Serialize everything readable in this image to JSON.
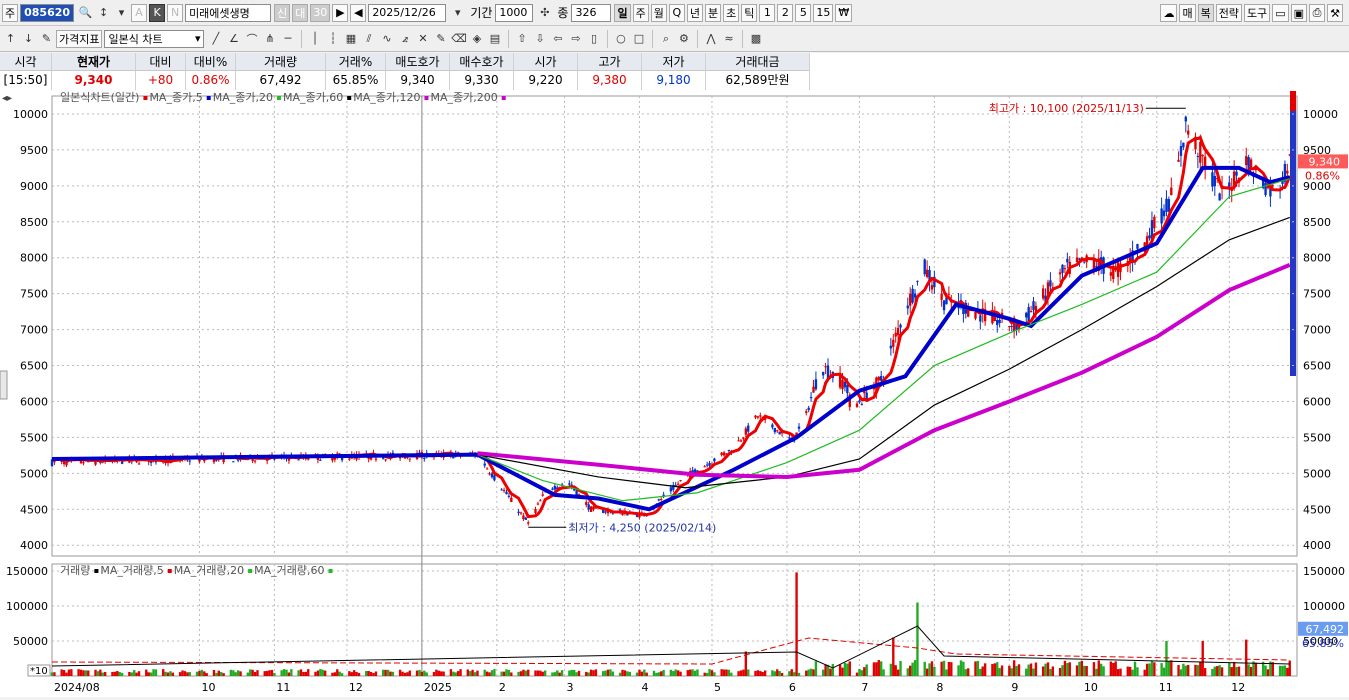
{
  "toolbar1": {
    "prefix": "주",
    "stock_code": "085620",
    "stock_name": "미래에셋생명",
    "badge1": "신",
    "badge2": "대",
    "badge3": "30",
    "date": "2025/12/26",
    "period_label": "기간",
    "period_value": "1000",
    "count_label": "종",
    "count_value": "326",
    "periods": [
      "일",
      "주",
      "월",
      "Q",
      "년",
      "분",
      "초",
      "틱",
      "1",
      "2",
      "5",
      "15"
    ],
    "right_buttons": [
      "매",
      "복",
      "전략",
      "도구"
    ]
  },
  "toolbar2": {
    "indicator_button": "가격지표",
    "chart_type": "일본식 차트",
    "view_button": "보기"
  },
  "quote": {
    "headers": [
      "시각",
      "현재가",
      "대비",
      "대비%",
      "거래량",
      "거래%",
      "매도호가",
      "매수호가",
      "시가",
      "고가",
      "저가",
      "거래대금"
    ],
    "values": [
      "[15:50]",
      "9,340",
      "+80",
      "0.86%",
      "67,492",
      "65.85%",
      "9,340",
      "9,330",
      "9,220",
      "9,380",
      "9,180",
      "62,589만원"
    ]
  },
  "legend": {
    "price_title": "일본식차트(일간)",
    "price_items": [
      {
        "label": "MA_종가,5",
        "color": "#e00000"
      },
      {
        "label": "MA_종가,20",
        "color": "#0000cc"
      },
      {
        "label": "MA_종가,60",
        "color": "#22bb22"
      },
      {
        "label": "MA_종가,120",
        "color": "#000000"
      },
      {
        "label": "MA_종가,200",
        "color": "#cc00cc"
      }
    ],
    "volume_title": "거래량",
    "volume_items": [
      {
        "label": "MA_거래량,5",
        "color": "#000000"
      },
      {
        "label": "MA_거래량,20",
        "color": "#e00000"
      },
      {
        "label": "MA_거래량,60",
        "color": "#22bb22"
      }
    ]
  },
  "annotations": {
    "high": "최고가 : 10,100 (2025/11/13)",
    "low": "최저가 : 4,250 (2025/02/14)",
    "current_price": "9,340",
    "current_change": "0.86%",
    "current_volume": "67,492",
    "volume_pct": "65.85%",
    "volume_unit": "*10"
  },
  "chart_data": {
    "type": "candlestick",
    "price_axis": {
      "ticks": [
        4000,
        4500,
        5000,
        5500,
        6000,
        6500,
        7000,
        7500,
        8000,
        8500,
        9000,
        9500,
        10000
      ],
      "ylim": [
        3850,
        10250
      ]
    },
    "volume_axis": {
      "ticks": [
        50000,
        100000,
        150000
      ],
      "ylim": [
        0,
        160000
      ]
    },
    "x_labels": [
      "2024/08",
      "10",
      "11",
      "12",
      "2025",
      "2",
      "3",
      "4",
      "5",
      "6",
      "7",
      "8",
      "9",
      "10",
      "11",
      "12"
    ],
    "price_anchors": [
      [
        "2024-08-01",
        5150
      ],
      [
        "2024-10-01",
        5200
      ],
      [
        "2024-12-01",
        5230
      ],
      [
        "2025-01-24",
        5260
      ],
      [
        "2025-02-14",
        4300
      ],
      [
        "2025-02-22",
        4800
      ],
      [
        "2025-03-03",
        4850
      ],
      [
        "2025-03-12",
        4500
      ],
      [
        "2025-04-03",
        4420
      ],
      [
        "2025-04-20",
        4950
      ],
      [
        "2025-05-10",
        5350
      ],
      [
        "2025-05-20",
        5800
      ],
      [
        "2025-06-03",
        5450
      ],
      [
        "2025-06-08",
        5700
      ],
      [
        "2025-06-15",
        6500
      ],
      [
        "2025-06-25",
        6250
      ],
      [
        "2025-06-28",
        5900
      ],
      [
        "2025-07-10",
        6300
      ],
      [
        "2025-07-20",
        7300
      ],
      [
        "2025-07-28",
        7850
      ],
      [
        "2025-08-05",
        7400
      ],
      [
        "2025-08-15",
        7300
      ],
      [
        "2025-08-25",
        7150
      ],
      [
        "2025-09-05",
        7050
      ],
      [
        "2025-09-10",
        7250
      ],
      [
        "2025-09-25",
        7850
      ],
      [
        "2025-10-05",
        7950
      ],
      [
        "2025-10-15",
        7800
      ],
      [
        "2025-10-25",
        8100
      ],
      [
        "2025-11-01",
        8500
      ],
      [
        "2025-11-08",
        8900
      ],
      [
        "2025-11-13",
        9850
      ],
      [
        "2025-11-19",
        9450
      ],
      [
        "2025-11-28",
        8850
      ],
      [
        "2025-12-08",
        9350
      ],
      [
        "2025-12-15",
        9050
      ],
      [
        "2025-12-20",
        8900
      ],
      [
        "2025-12-26",
        9340
      ]
    ],
    "ma": [
      {
        "name": "MA_종가,20",
        "color": "#0000cc",
        "points": [
          [
            "2024-08-01",
            5200
          ],
          [
            "2025-01-24",
            5260
          ],
          [
            "2025-02-25",
            4700
          ],
          [
            "2025-03-15",
            4650
          ],
          [
            "2025-04-05",
            4500
          ],
          [
            "2025-05-10",
            5050
          ],
          [
            "2025-06-05",
            5500
          ],
          [
            "2025-07-01",
            6150
          ],
          [
            "2025-07-20",
            6350
          ],
          [
            "2025-08-10",
            7350
          ],
          [
            "2025-09-01",
            7150
          ],
          [
            "2025-09-10",
            7050
          ],
          [
            "2025-10-01",
            7750
          ],
          [
            "2025-11-01",
            8200
          ],
          [
            "2025-11-20",
            9250
          ],
          [
            "2025-12-05",
            9250
          ],
          [
            "2025-12-18",
            9050
          ],
          [
            "2025-12-26",
            9120
          ]
        ]
      },
      {
        "name": "MA_종가,60",
        "color": "#22bb22",
        "points": [
          [
            "2025-01-24",
            5260
          ],
          [
            "2025-02-20",
            4900
          ],
          [
            "2025-03-25",
            4620
          ],
          [
            "2025-04-25",
            4730
          ],
          [
            "2025-06-01",
            5150
          ],
          [
            "2025-07-01",
            5600
          ],
          [
            "2025-08-01",
            6500
          ],
          [
            "2025-09-01",
            6950
          ],
          [
            "2025-10-01",
            7350
          ],
          [
            "2025-11-01",
            7800
          ],
          [
            "2025-12-01",
            8850
          ],
          [
            "2025-12-26",
            9100
          ]
        ]
      },
      {
        "name": "MA_종가,120",
        "color": "#000000",
        "points": [
          [
            "2025-01-24",
            5260
          ],
          [
            "2025-03-15",
            4950
          ],
          [
            "2025-04-20",
            4800
          ],
          [
            "2025-06-01",
            4950
          ],
          [
            "2025-07-01",
            5200
          ],
          [
            "2025-08-01",
            5950
          ],
          [
            "2025-09-01",
            6450
          ],
          [
            "2025-10-01",
            7000
          ],
          [
            "2025-11-01",
            7600
          ],
          [
            "2025-12-01",
            8250
          ],
          [
            "2025-12-26",
            8560
          ]
        ]
      },
      {
        "name": "MA_종가,200",
        "color": "#cc00cc",
        "points": [
          [
            "2025-01-24",
            5280
          ],
          [
            "2025-03-15",
            5120
          ],
          [
            "2025-04-25",
            4980
          ],
          [
            "2025-06-01",
            4950
          ],
          [
            "2025-07-01",
            5050
          ],
          [
            "2025-08-01",
            5600
          ],
          [
            "2025-09-01",
            6000
          ],
          [
            "2025-10-01",
            6400
          ],
          [
            "2025-11-01",
            6900
          ],
          [
            "2025-12-01",
            7550
          ],
          [
            "2025-12-26",
            7900
          ]
        ]
      }
    ],
    "volume_spikes": [
      [
        "2025-06-05",
        148000
      ],
      [
        "2025-07-20",
        140000
      ],
      [
        "2025-07-25",
        105000
      ],
      [
        "2025-06-08",
        60000
      ],
      [
        "2025-07-15",
        55000
      ],
      [
        "2025-08-10",
        45000
      ],
      [
        "2025-10-05",
        55000
      ],
      [
        "2025-11-05",
        50000
      ],
      [
        "2025-11-20",
        50000
      ],
      [
        "2025-12-08",
        52000
      ],
      [
        "2025-05-15",
        35000
      ]
    ]
  }
}
